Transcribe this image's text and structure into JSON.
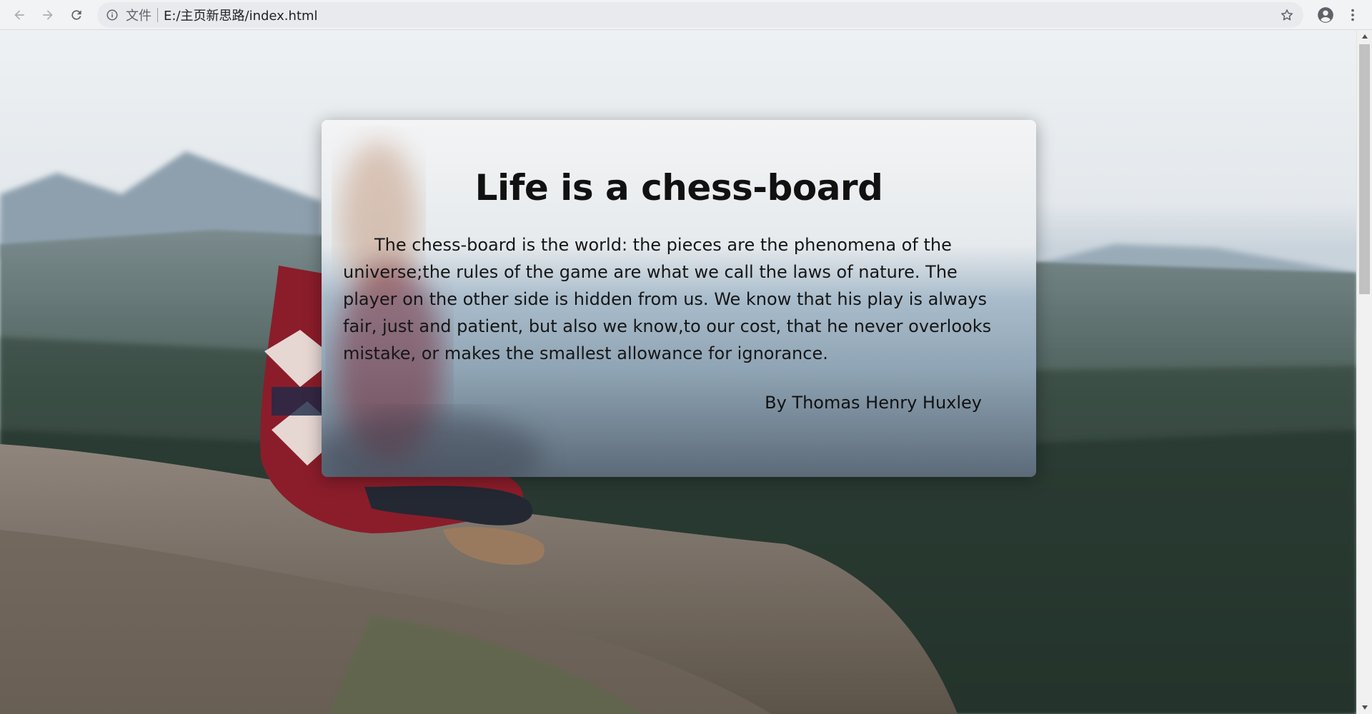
{
  "browser": {
    "back_icon": "arrow-left-icon",
    "forward_icon": "arrow-right-icon",
    "reload_icon": "reload-icon",
    "omnibox": {
      "info_icon": "info-icon",
      "scheme_label": "文件",
      "url": "E:/主页新思路/index.html",
      "bookmark_icon": "star-icon"
    },
    "account_icon": "account-circle-icon",
    "menu_icon": "vertical-dots-icon"
  },
  "page": {
    "card": {
      "title": "Life is a chess-board",
      "body": "The chess-board is the world: the pieces are the phenomena of the universe;the rules of the game are what we call the laws of nature. The player on the other side is hidden from us. We know that his play is always fair, just and patient, but also we know,to our cost, that he never overlooks mistake, or makes the smallest allowance for ignorance.",
      "author": "By Thomas Henry Huxley"
    },
    "background_image": "person-sitting-on-cliff-overlooking-forest"
  },
  "colors": {
    "toolbar_bg": "#f1f3f4",
    "omnibox_bg": "#e8eaed",
    "icon": "#5f6368",
    "text": "#202124"
  }
}
